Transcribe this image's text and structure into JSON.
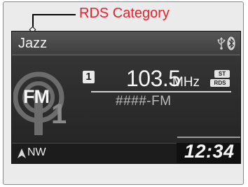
{
  "callout": {
    "label": "RDS Category"
  },
  "screen": {
    "category": "Jazz",
    "band": "FM",
    "band_number": "1",
    "preset": "1",
    "frequency": "103.5",
    "frequency_unit": "MHz",
    "badges": {
      "stereo": "ST",
      "rds": "RDS"
    },
    "station_name": "####-FM",
    "compass": "NW",
    "clock": "12:34"
  },
  "icons": {
    "usb": "usb-icon",
    "bluetooth": "bluetooth-icon",
    "compass_arrow": "compass-arrow-icon",
    "fm_emblem": "fm-band-icon"
  },
  "colors": {
    "callout_text": "#e8202a",
    "screen_background": "#2e2e2e",
    "text_primary": "#f5f5f5"
  }
}
